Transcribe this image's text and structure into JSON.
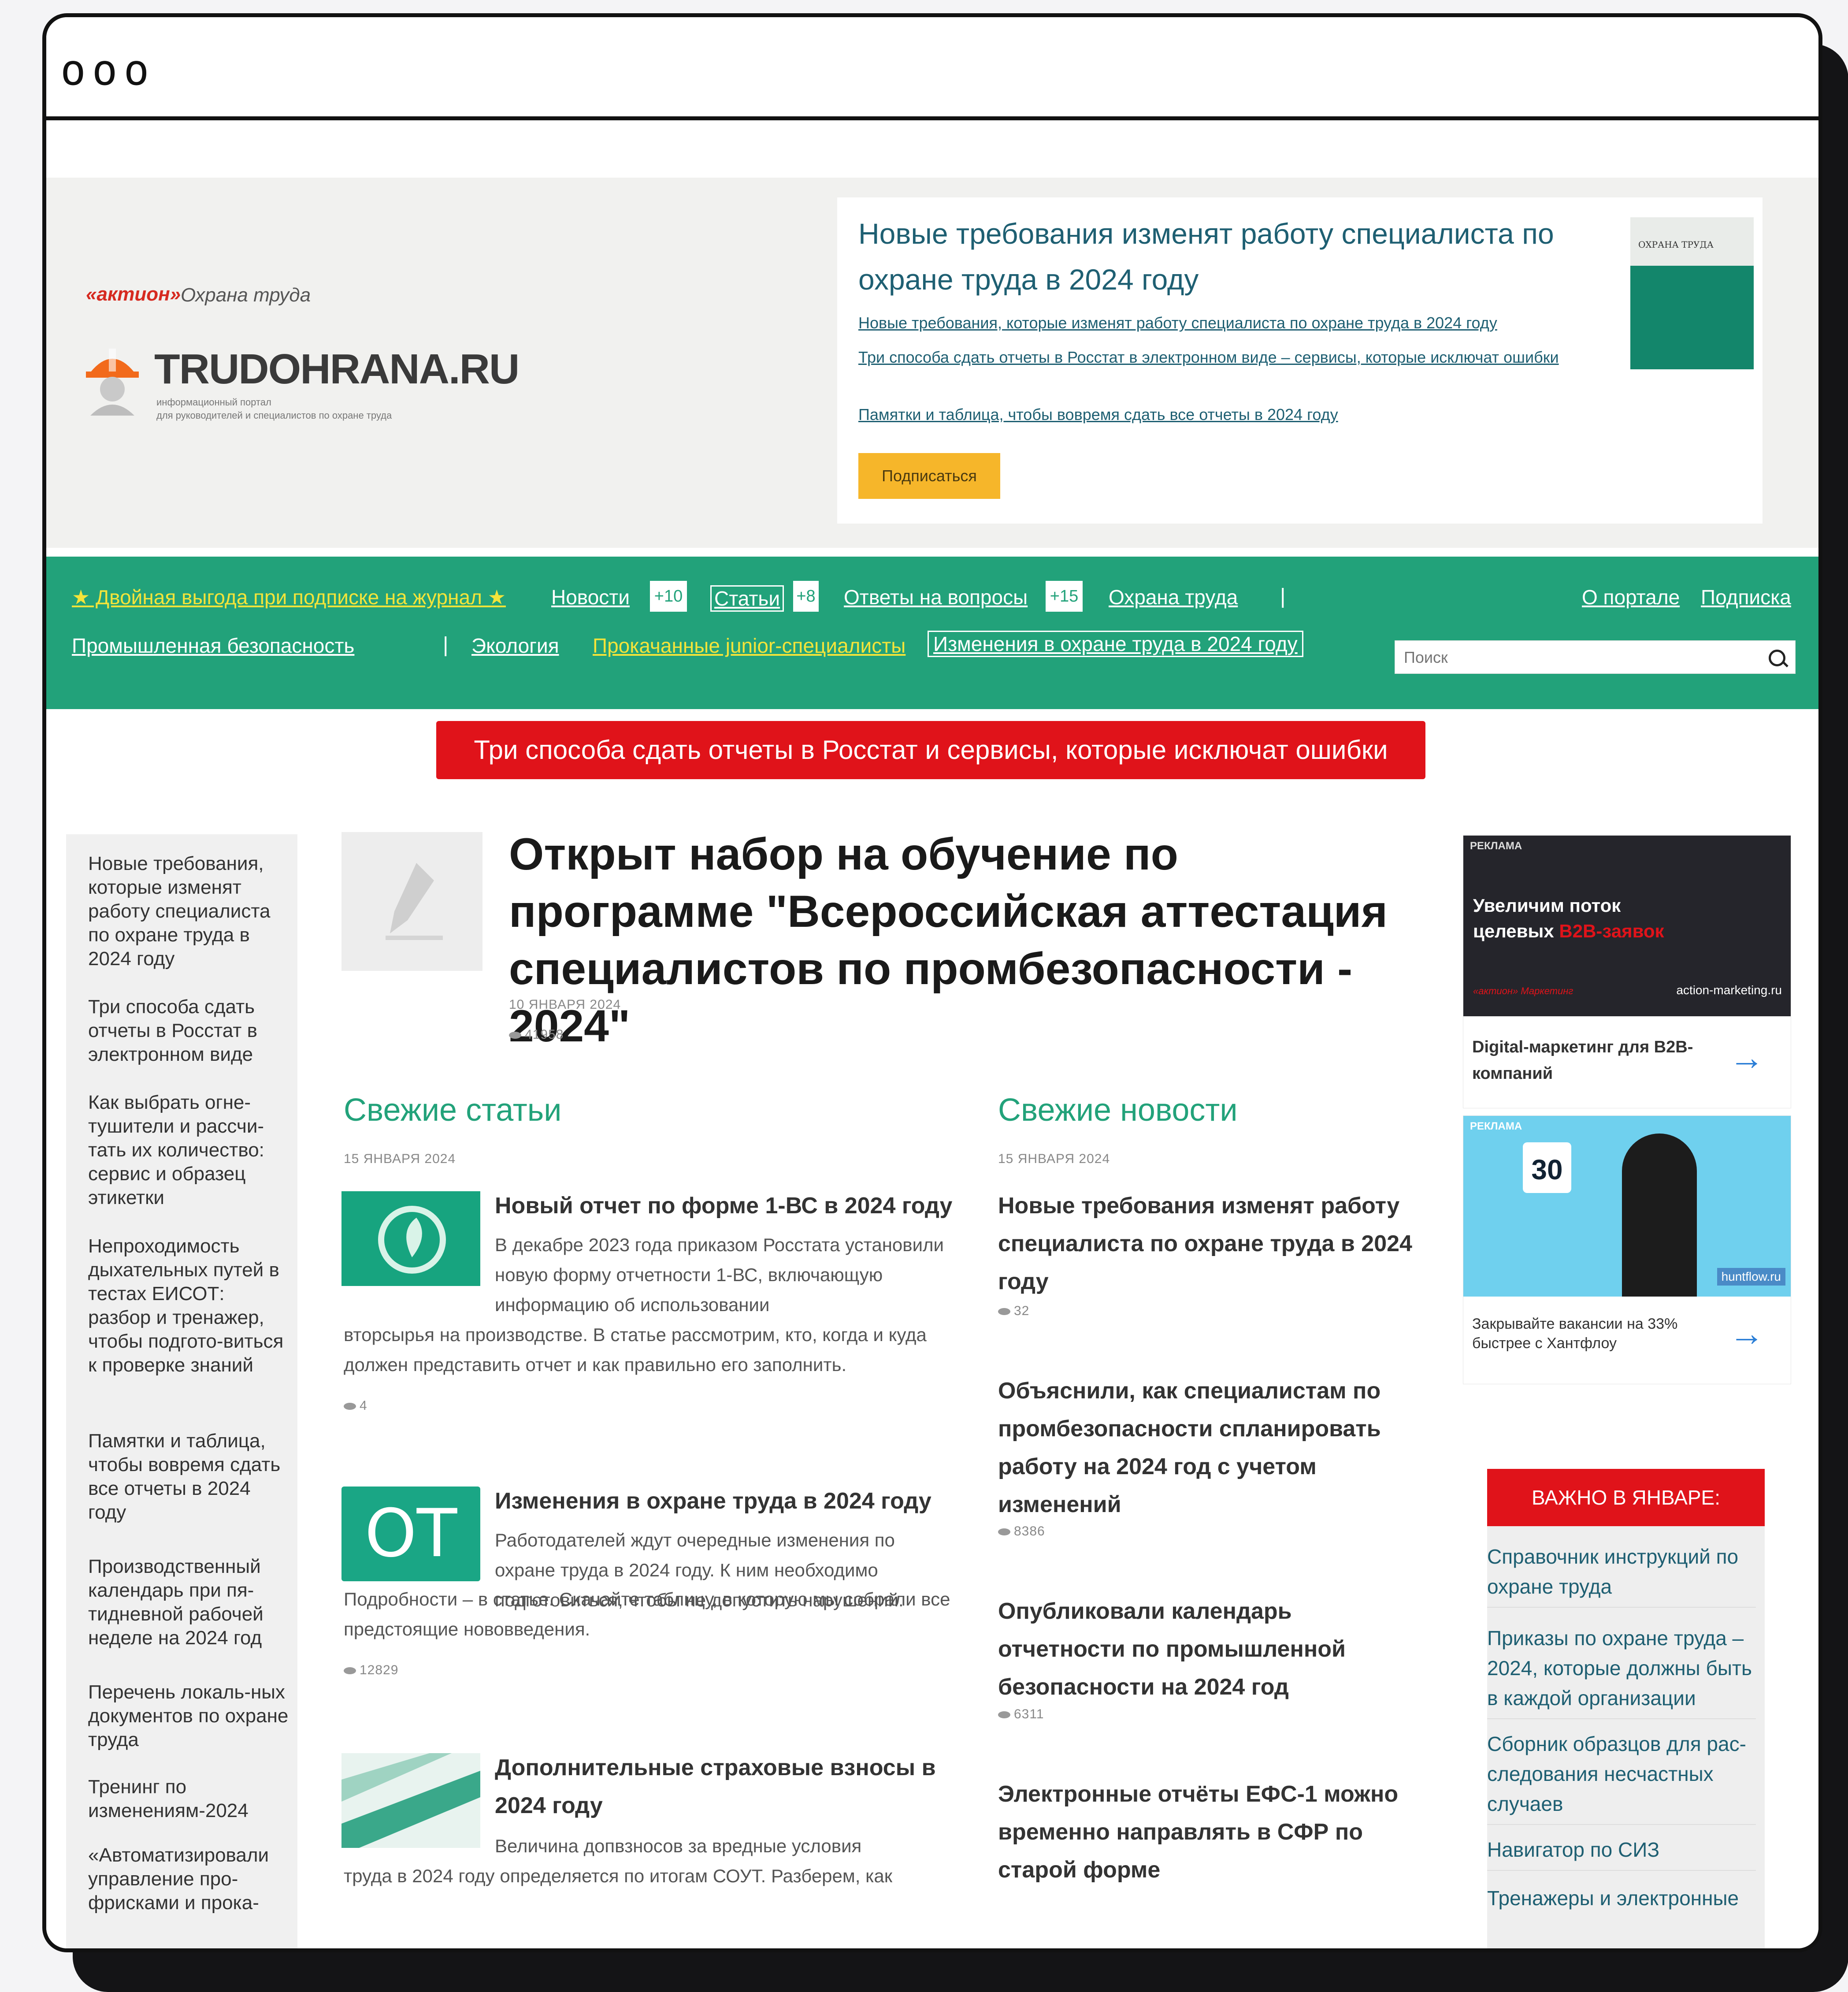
{
  "window": {
    "dots": "ooo"
  },
  "header": {
    "aktion": "«актион»",
    "aktion_sub": "Охрана труда",
    "brand": "TRUDOHRANA.RU",
    "brand_sub": "информационный портал\nдля руководителей и специалистов по охране труда"
  },
  "promo": {
    "title": "Новые требования изменят работу специалиста по охране труда в 2024 году",
    "links": [
      "Новые требования, которые изменят работу специалиста по охране труда в 2024 году",
      "Три способа сдать отчеты в Росстат в электронном виде – сервисы, которые исключат ошибки",
      "Памятки и таблица, чтобы вовремя сдать все отчеты в 2024 году"
    ],
    "button": "Подписаться",
    "magazine_title": "ОХРАНА ТРУДА"
  },
  "nav": {
    "promo": "★ Двойная выгода при подписке на журнал ★",
    "news": "Новости",
    "news_count": "+10",
    "articles": "Статьи",
    "articles_count": "+8",
    "answers": "Ответы на вопросы",
    "answers_count": "+15",
    "labor": "Охрана труда",
    "sep": "|",
    "about": "О портале",
    "subscribe": "Подписка",
    "industrial": "Промышленная безопасность",
    "ecology": "Экология",
    "junior": "Прокачанные junior-специалисты",
    "changes": "Изменения в охране труда в 2024 году",
    "search_placeholder": "Поиск"
  },
  "red_banner": "Три способа сдать отчеты в Росстат и сервисы, которые исключат ошибки",
  "left_items": [
    "Новые требования, которые изменят работу специалиста по охране труда в 2024 году",
    "Три способа сдать отчеты в Росстат в электронном виде",
    "Как выбрать огне-тушители и рассчи-тать их количество: сервис и образец этикетки",
    "Непроходимость дыхательных путей в тестах ЕИСОТ: разбор и тренажер, чтобы подгото-виться к проверке знаний",
    "Памятки и таблица, чтобы вовремя сдать все отчеты в 2024 году",
    "Производственный календарь при пя-тидневной рабочей неделе на 2024 год",
    "Перечень локаль-ных документов по охране труда",
    "Тренинг по изменениям-2024",
    "«Автоматизировали управление про-фрисками и прока-"
  ],
  "hero": {
    "title": "Открыт набор на обучение по программе \"Всероссийская аттестация специалистов по промбезопасности - 2024\"",
    "date": "10 ЯНВАРЯ 2024",
    "views": "41958"
  },
  "articles": {
    "title": "Свежие статьи",
    "date": "15 ЯНВАРЯ 2024",
    "items": [
      {
        "title": "Новый отчет по форме 1-ВС в 2024 году",
        "text_first": "В декабре 2023 года приказом Росстата установили новую форму отчетности 1-ВС, включающую информацию об использовании",
        "text_rest": "вторсырья на производстве. В статье рассмотрим, кто, когда и куда должен представить отчет и как правильно его заполнить.",
        "views": "4"
      },
      {
        "title": "Изменения в охране труда в 2024 году",
        "text_first": "Работодателей ждут очередные изменения по охране труда в 2024 году. К ним необходимо подготовиться, чтобы не допустить нарушений.",
        "text_rest": "Подробности – в статье. Скачайте таблицу, в которую мы собрали все предстоящие нововведения.",
        "views": "12829",
        "thumb_label": "OT"
      },
      {
        "title": "Дополнительные страховые взносы в 2024 году",
        "text_first": "Величина допвзносов за вредные условия",
        "text_rest": "труда в 2024 году определяется по итогам СОУТ. Разберем, как",
        "views": ""
      }
    ]
  },
  "news": {
    "title": "Свежие новости",
    "date": "15 ЯНВАРЯ 2024",
    "items": [
      {
        "title": "Новые требования изменят работу специалиста по охране труда в 2024 году",
        "views": "32"
      },
      {
        "title": "Объяснили, как специалистам по промбезопасности спланировать работу на 2024 год с учетом изменений",
        "views": "8386"
      },
      {
        "title": "Опубликовали календарь отчетности по промышленной безопасности на 2024 год",
        "views": "6311"
      },
      {
        "title": "Электронные отчёты ЕФС-1 можно временно направлять в СФР по старой форме",
        "views": ""
      }
    ]
  },
  "ads": [
    {
      "badge": "РЕКЛАМА",
      "headline": "Увеличим поток целевых",
      "accent": "B2B-заявок",
      "footer_left": "«актион» Маркетинг",
      "footer_right": "action-marketing.ru",
      "caption": "Digital-маркетинг для B2B-компаний"
    },
    {
      "badge": "РЕКЛАМА",
      "number": "30",
      "brand": "huntflow.ru",
      "caption": "Закрывайте вакансии на 33% быстрее с Хантфлоу"
    }
  ],
  "important": {
    "title": "ВАЖНО В ЯНВАРЕ:",
    "items": [
      "Справочник инструкций по охране труда",
      "Приказы по охране труда – 2024, которые должны быть в каждой организации",
      "Сборник образцов для рас-следования несчастных случаев",
      "Навигатор по СИЗ",
      "Тренажеры и электронные"
    ]
  },
  "colors": {
    "green": "#22a27a",
    "red": "#e0131a",
    "yellow": "#f6b62a",
    "link": "#1e5f72"
  }
}
